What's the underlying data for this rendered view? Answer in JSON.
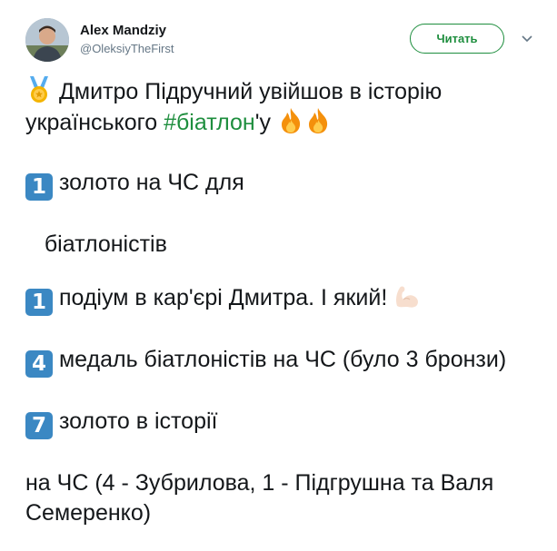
{
  "author": {
    "name": "Alex Mandziy",
    "handle": "@OleksiyTheFirst"
  },
  "follow_label": "Читать",
  "tweet": {
    "line1": "Дмитро Підручний увійшов в історію",
    "line2_a": "українського ",
    "hashtag": "#біатлон",
    "line2_b": "'у",
    "p2_num": "1",
    "p2_a": "золото на ЧС для",
    "p2_b": "біатлоністів",
    "p3_num": "1",
    "p3_text": "подіум в кар'єрі Дмитра. І який!",
    "p4_num": "4",
    "p4_text": "медаль біатлоністів на ЧС (було 3 бронзи)",
    "p5_num": "7",
    "p5_a": "золото в історії",
    "p5_b": "на ЧС (4 - Зубрилова, 1 - Підгрушна та Валя Семеренко)"
  },
  "icons": {
    "medal": "sports-medal-icon",
    "fire": "fire-icon",
    "flag": "ukraine-flag-icon",
    "biceps": "flexed-biceps-icon",
    "chevron": "chevron-down-icon"
  },
  "colors": {
    "accent": "#1e8e3e",
    "keycap": "#3b88c3",
    "flag_blue": "#005bbb",
    "flag_yellow": "#ffd500"
  }
}
